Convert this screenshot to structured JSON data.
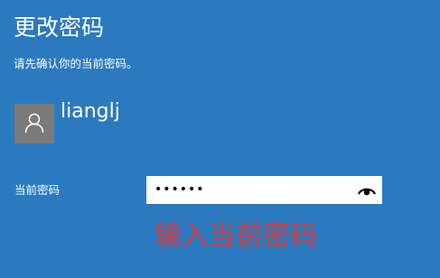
{
  "header": {
    "title": "更改密码",
    "subtitle": "请先确认你的当前密码。"
  },
  "account": {
    "avatar_icon": "user-icon",
    "username": "lianglj"
  },
  "password_form": {
    "label": "当前密码",
    "value": "••••••",
    "reveal_icon": "eye-icon"
  },
  "annotation": {
    "text": "输入当前密码",
    "color": "#e03a3a"
  },
  "colors": {
    "background": "#2b7ac0",
    "avatar_background": "#7a7a7a",
    "text": "#ffffff"
  }
}
